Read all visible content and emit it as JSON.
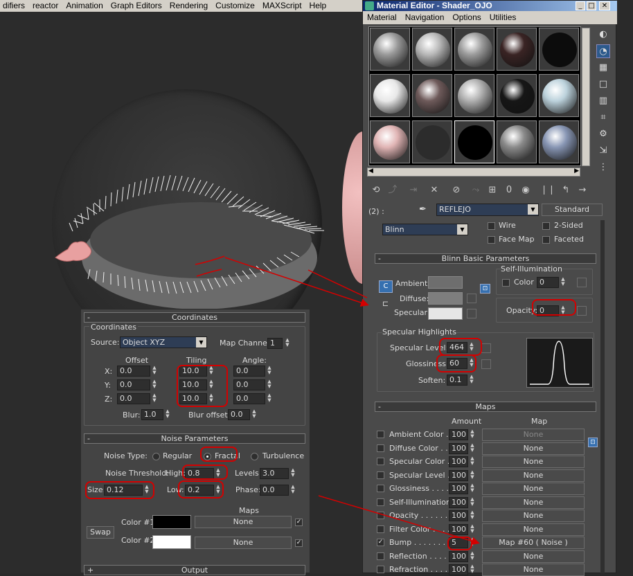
{
  "menubar": [
    "difiers",
    "reactor",
    "Animation",
    "Graph Editors",
    "Rendering",
    "Customize",
    "MAXScript",
    "Help"
  ],
  "material_editor": {
    "title": "Material Editor - Shader_OJO",
    "menu": [
      "Material",
      "Navigation",
      "Options",
      "Utilities"
    ],
    "slot_count": 15,
    "slot_colors": [
      "#9a9a9a",
      "#b8b8b8",
      "#9c9c9c",
      "#3a2424",
      "#0c0c0c",
      "#e8e8e8",
      "#6e5a5a",
      "#b0b0b0",
      "#161616",
      "#bcd2dc",
      "#e0b4b4",
      "#2c2c2c",
      "#000000",
      "#8a8a8a",
      "#8896b4"
    ],
    "mat_id": "(2) :",
    "mat_name": "REFLEJO",
    "mat_type": "Standard",
    "shader": "Blinn",
    "flags": {
      "wire": "Wire",
      "two_sided": "2-Sided",
      "face_map": "Face Map",
      "faceted": "Faceted"
    },
    "blinn": {
      "title": "Blinn Basic Parameters",
      "ambient": "Ambient:",
      "diffuse": "Diffuse:",
      "specular": "Specular:",
      "self_illum_title": "Self-Illumination",
      "color_label": "Color",
      "color_value": "0",
      "opacity_label": "Opacity:",
      "opacity_value": "0",
      "spec_title": "Specular Highlights",
      "spec_level_label": "Specular Level:",
      "spec_level": "464",
      "gloss_label": "Glossiness:",
      "gloss": "60",
      "soften_label": "Soften:",
      "soften": "0.1"
    },
    "maps": {
      "title": "Maps",
      "amount_header": "Amount",
      "map_header": "Map",
      "rows": [
        {
          "name": "Ambient Color . .",
          "amount": "100",
          "map": "None",
          "checked": false
        },
        {
          "name": "Diffuse Color . .",
          "amount": "100",
          "map": "None",
          "checked": false
        },
        {
          "name": "Specular Color . .",
          "amount": "100",
          "map": "None",
          "checked": false
        },
        {
          "name": "Specular Level . .",
          "amount": "100",
          "map": "None",
          "checked": false
        },
        {
          "name": "Glossiness . . . . . .",
          "amount": "100",
          "map": "None",
          "checked": false
        },
        {
          "name": "Self-Illumination . .",
          "amount": "100",
          "map": "None",
          "checked": false
        },
        {
          "name": "Opacity . . . . . . . .",
          "amount": "100",
          "map": "None",
          "checked": false
        },
        {
          "name": "Filter Color . . . . .",
          "amount": "100",
          "map": "None",
          "checked": false
        },
        {
          "name": "Bump . . . . . . . . .",
          "amount": "5",
          "map": "Map #60  ( Noise )",
          "checked": true
        },
        {
          "name": "Reflection . . . . . .",
          "amount": "100",
          "map": "None",
          "checked": false
        },
        {
          "name": "Refraction . . . . .",
          "amount": "100",
          "map": "None",
          "checked": false
        }
      ]
    }
  },
  "coordinates": {
    "title": "Coordinates",
    "group": "Coordinates",
    "source_label": "Source:",
    "source": "Object XYZ",
    "map_channel_label": "Map Channel:",
    "map_channel": "1",
    "offset_header": "Offset",
    "tiling_header": "Tiling",
    "angle_header": "Angle:",
    "rows": [
      {
        "axis": "X:",
        "offset": "0.0",
        "tiling": "10.0",
        "angle": "0.0"
      },
      {
        "axis": "Y:",
        "offset": "0.0",
        "tiling": "10.0",
        "angle": "0.0"
      },
      {
        "axis": "Z:",
        "offset": "0.0",
        "tiling": "10.0",
        "angle": "0.0"
      }
    ],
    "blur_label": "Blur:",
    "blur": "1.0",
    "blur_offset_label": "Blur offset:",
    "blur_offset": "0.0"
  },
  "noise": {
    "title": "Noise Parameters",
    "type_label": "Noise Type:",
    "regular": "Regular",
    "fractal": "Fractal",
    "turbulence": "Turbulence",
    "threshold_label": "Noise Threshold:",
    "high_label": "High:",
    "high": "0.8",
    "levels_label": "Levels:",
    "levels": "3.0",
    "size_label": "Size:",
    "size": "0.12",
    "low_label": "Low:",
    "low": "0.2",
    "phase_label": "Phase:",
    "phase": "0.0",
    "maps_header": "Maps",
    "swap": "Swap",
    "color1_label": "Color #1",
    "color2_label": "Color #2",
    "color1": "#000000",
    "color2": "#ffffff",
    "map1": "None",
    "map2": "None"
  },
  "output_title": "Output",
  "accent_red": "#d40000"
}
